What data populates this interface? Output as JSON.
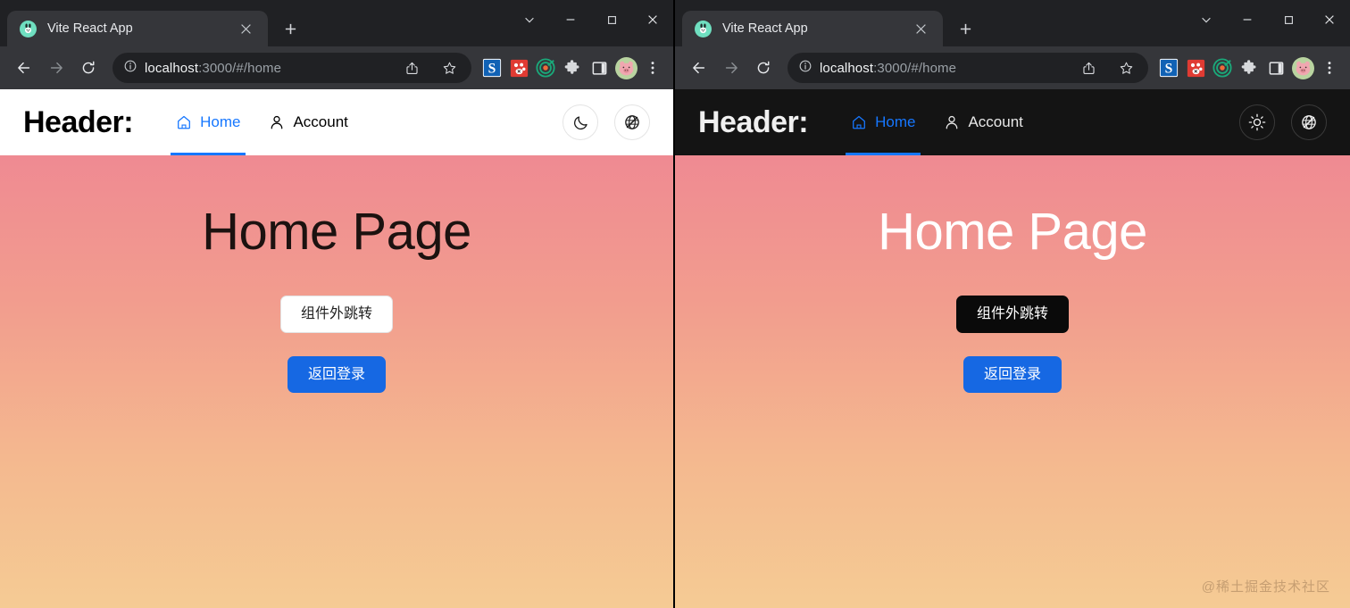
{
  "windows": [
    {
      "theme": "light",
      "browser": {
        "tab": {
          "title": "Vite React App",
          "favicon": "rabbit-favicon"
        },
        "newtab_label": "+",
        "controls": [
          "tab-search-chevron",
          "minimize",
          "maximize",
          "close"
        ],
        "nav": {
          "back": "back-arrow",
          "forward": "forward-arrow",
          "reload": "reload-arrow"
        },
        "omnibox": {
          "site_info_icon": "info-circle-icon",
          "url_host": "localhost",
          "url_rest": ":3000/#/home",
          "url_full": "localhost:3000/#/home",
          "share_icon": "share-icon",
          "bookmark_icon": "star-icon"
        },
        "extensions": [
          "sogou-s-extension",
          "redpaw-extension",
          "target-extension",
          "puzzle-extensions",
          "sidepanel-icon",
          "profile-avatar"
        ],
        "menu_icon": "three-dot-menu-icon"
      },
      "app": {
        "brand": "Header:",
        "nav": [
          {
            "label": "Home",
            "icon": "home-icon",
            "active": true
          },
          {
            "label": "Account",
            "icon": "user-icon",
            "active": false
          }
        ],
        "actions": [
          {
            "name": "theme-toggle-button",
            "icon": "moon-icon"
          },
          {
            "name": "language-toggle-button",
            "icon": "globe-slash-icon"
          }
        ],
        "title": "Home Page",
        "buttons": [
          {
            "label": "组件外跳转",
            "style": "ghost"
          },
          {
            "label": "返回登录",
            "style": "primary"
          }
        ],
        "watermark": ""
      }
    },
    {
      "theme": "dark",
      "browser": {
        "tab": {
          "title": "Vite React App",
          "favicon": "rabbit-favicon"
        },
        "newtab_label": "+",
        "controls": [
          "tab-search-chevron",
          "minimize",
          "maximize",
          "close"
        ],
        "nav": {
          "back": "back-arrow",
          "forward": "forward-arrow",
          "reload": "reload-arrow"
        },
        "omnibox": {
          "site_info_icon": "info-circle-icon",
          "url_host": "localhost",
          "url_rest": ":3000/#/home",
          "url_full": "localhost:3000/#/home",
          "share_icon": "share-icon",
          "bookmark_icon": "star-icon"
        },
        "extensions": [
          "sogou-s-extension",
          "redpaw-extension",
          "target-extension",
          "puzzle-extensions",
          "sidepanel-icon",
          "profile-avatar"
        ],
        "menu_icon": "three-dot-menu-icon"
      },
      "app": {
        "brand": "Header:",
        "nav": [
          {
            "label": "Home",
            "icon": "home-icon",
            "active": true
          },
          {
            "label": "Account",
            "icon": "user-icon",
            "active": false
          }
        ],
        "actions": [
          {
            "name": "theme-toggle-button",
            "icon": "sun-icon"
          },
          {
            "name": "language-toggle-button",
            "icon": "globe-slash-icon"
          }
        ],
        "title": "Home Page",
        "buttons": [
          {
            "label": "组件外跳转",
            "style": "ghost"
          },
          {
            "label": "返回登录",
            "style": "primary"
          }
        ],
        "watermark": "@稀土掘金技术社区"
      }
    }
  ],
  "colors": {
    "accent_blue": "#1677ff",
    "primary_button": "#1668e3",
    "gradient_top": "#ef8a92",
    "gradient_bottom": "#f5cb94",
    "light_header_bg": "#ffffff",
    "dark_header_bg": "#141414",
    "chrome_bg": "#35363a",
    "chrome_dark": "#202124"
  }
}
